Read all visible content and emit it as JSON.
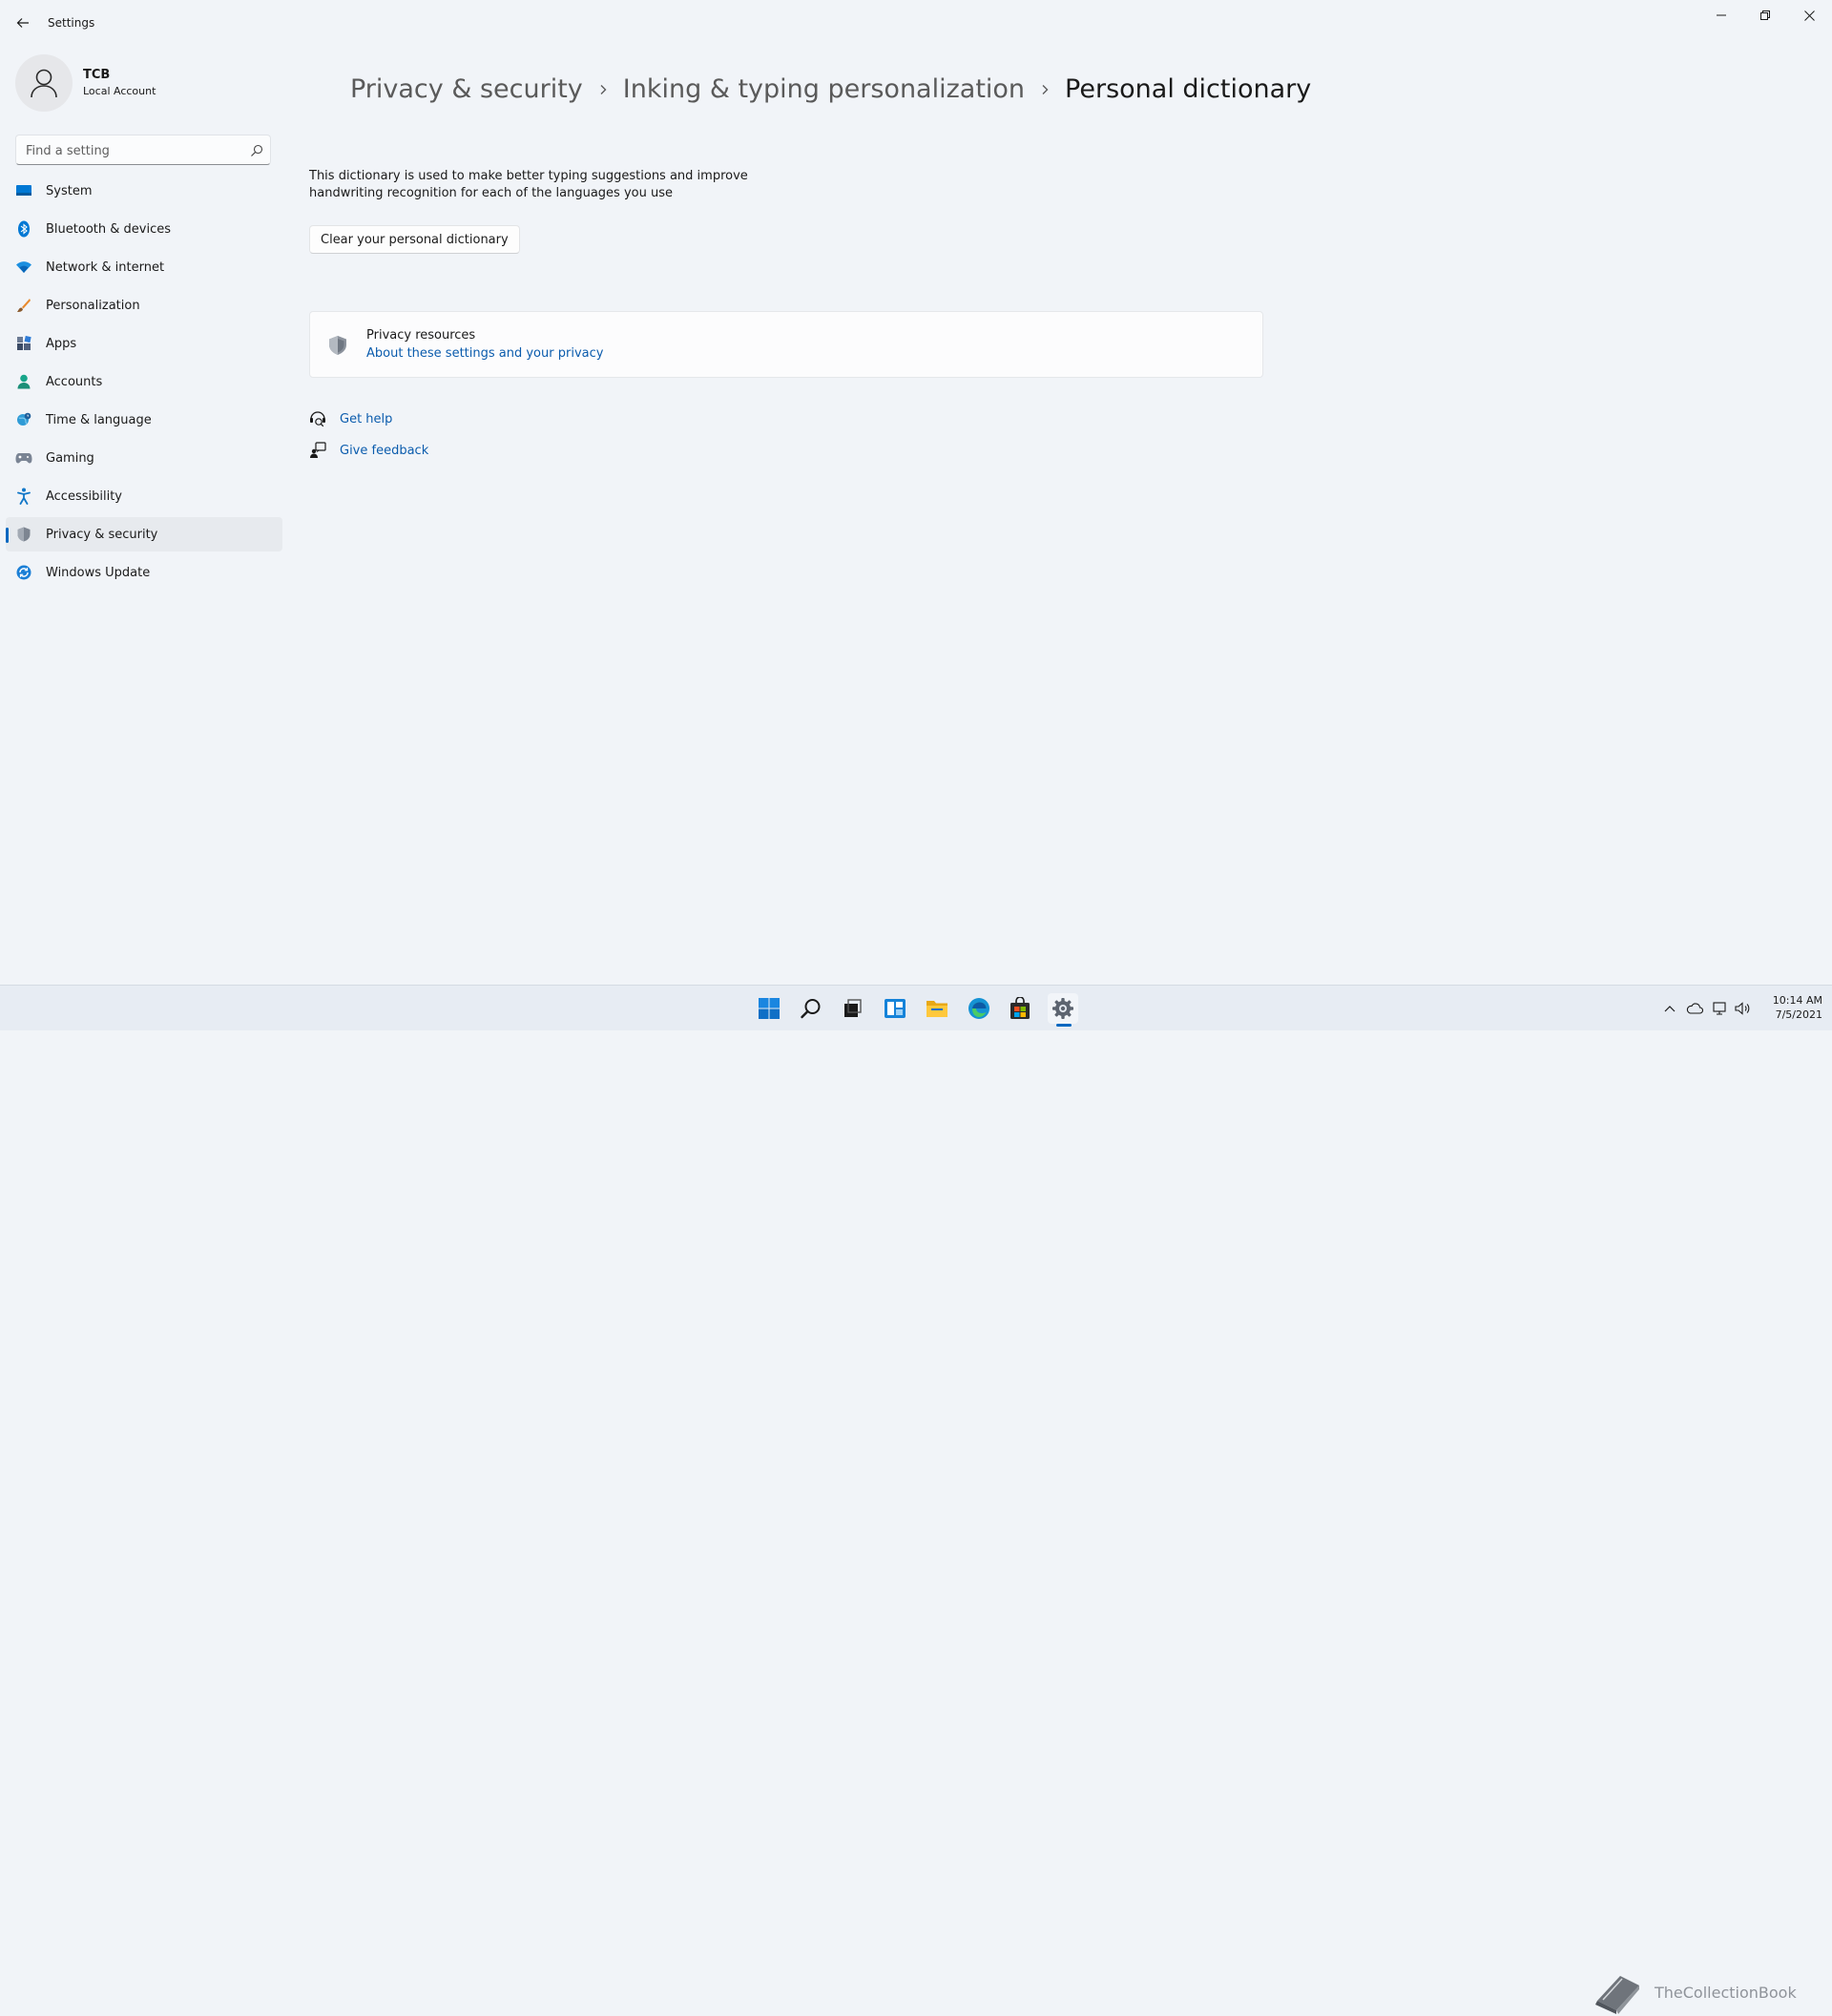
{
  "window": {
    "title": "Settings"
  },
  "profile": {
    "name": "TCB",
    "account_type": "Local Account"
  },
  "search": {
    "placeholder": "Find a setting"
  },
  "sidebar": {
    "items": [
      {
        "label": "System",
        "icon": "system-icon"
      },
      {
        "label": "Bluetooth & devices",
        "icon": "bluetooth-icon"
      },
      {
        "label": "Network & internet",
        "icon": "wifi-icon"
      },
      {
        "label": "Personalization",
        "icon": "brush-icon"
      },
      {
        "label": "Apps",
        "icon": "apps-icon"
      },
      {
        "label": "Accounts",
        "icon": "person-icon"
      },
      {
        "label": "Time & language",
        "icon": "globe-clock-icon"
      },
      {
        "label": "Gaming",
        "icon": "gamepad-icon"
      },
      {
        "label": "Accessibility",
        "icon": "accessibility-icon"
      },
      {
        "label": "Privacy & security",
        "icon": "shield-icon",
        "active": true
      },
      {
        "label": "Windows Update",
        "icon": "update-icon"
      }
    ]
  },
  "breadcrumb": {
    "items": [
      "Privacy & security",
      "Inking & typing personalization",
      "Personal dictionary"
    ]
  },
  "content": {
    "description_line1": "This dictionary is used to make better typing suggestions and improve",
    "description_line2": "handwriting recognition for each of the languages you use",
    "clear_button": "Clear your personal dictionary",
    "privacy_resources": {
      "title": "Privacy resources",
      "link": "About these settings and your privacy"
    },
    "get_help": "Get help",
    "give_feedback": "Give feedback"
  },
  "taskbar": {
    "apps": [
      "start-icon",
      "search-icon",
      "task-view-icon",
      "widgets-icon",
      "file-explorer-icon",
      "edge-icon",
      "store-icon",
      "settings-icon"
    ],
    "active_app": "settings-icon",
    "watermark_text": "TheCollectionBook",
    "time": "10:14 AM",
    "date": "7/5/2021"
  },
  "colors": {
    "accent": "#0067c0",
    "link": "#0b5cad",
    "background": "#f1f4f8"
  }
}
